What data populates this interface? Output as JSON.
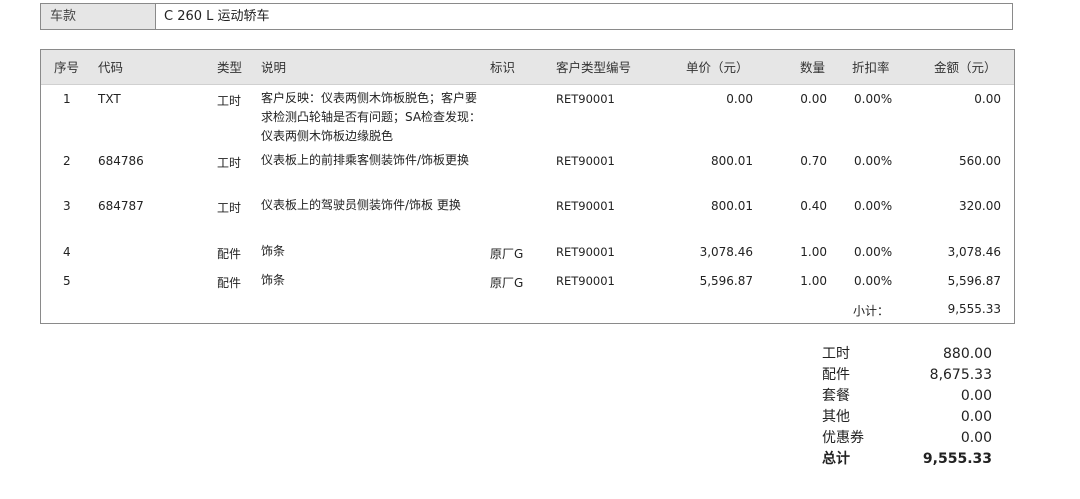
{
  "model": {
    "label": "车款",
    "value": "C 260 L 运动轿车"
  },
  "table": {
    "headers": {
      "seq": "序号",
      "code": "代码",
      "type": "类型",
      "desc": "说明",
      "mark": "标识",
      "custtype": "客户类型编号",
      "price": "单价（元）",
      "qty": "数量",
      "discount": "折扣率",
      "amount": "金额（元）"
    },
    "rows": [
      {
        "seq": "1",
        "code": "TXT",
        "type": "工时",
        "desc": "客户反映：仪表两侧木饰板脱色；客户要求检测凸轮轴是否有问题；SA检查发现：仪表两侧木饰板边缘脱色",
        "mark": "",
        "custtype": "RET90001",
        "price": "0.00",
        "qty": "0.00",
        "discount": "0.00%",
        "amount": "0.00"
      },
      {
        "seq": "2",
        "code": "684786",
        "type": "工时",
        "desc": "仪表板上的前排乘客侧装饰件/饰板更换",
        "mark": "",
        "custtype": "RET90001",
        "price": "800.01",
        "qty": "0.70",
        "discount": "0.00%",
        "amount": "560.00"
      },
      {
        "seq": "3",
        "code": "684787",
        "type": "工时",
        "desc": "仪表板上的驾驶员侧装饰件/饰板 更换",
        "mark": "",
        "custtype": "RET90001",
        "price": "800.01",
        "qty": "0.40",
        "discount": "0.00%",
        "amount": "320.00"
      },
      {
        "seq": "4",
        "code": "",
        "type": "配件",
        "desc": "饰条",
        "mark": "原厂G",
        "custtype": "RET90001",
        "price": "3,078.46",
        "qty": "1.00",
        "discount": "0.00%",
        "amount": "3,078.46"
      },
      {
        "seq": "5",
        "code": "",
        "type": "配件",
        "desc": "饰条",
        "mark": "原厂G",
        "custtype": "RET90001",
        "price": "5,596.87",
        "qty": "1.00",
        "discount": "0.00%",
        "amount": "5,596.87"
      }
    ],
    "subtotal_label": "小计：",
    "subtotal_value": "9,555.33"
  },
  "summary": [
    {
      "label": "工时",
      "value": "880.00"
    },
    {
      "label": "配件",
      "value": "8,675.33"
    },
    {
      "label": "套餐",
      "value": "0.00"
    },
    {
      "label": "其他",
      "value": "0.00"
    },
    {
      "label": "优惠券",
      "value": "0.00"
    }
  ],
  "total": {
    "label": "总计",
    "value": "9,555.33"
  }
}
